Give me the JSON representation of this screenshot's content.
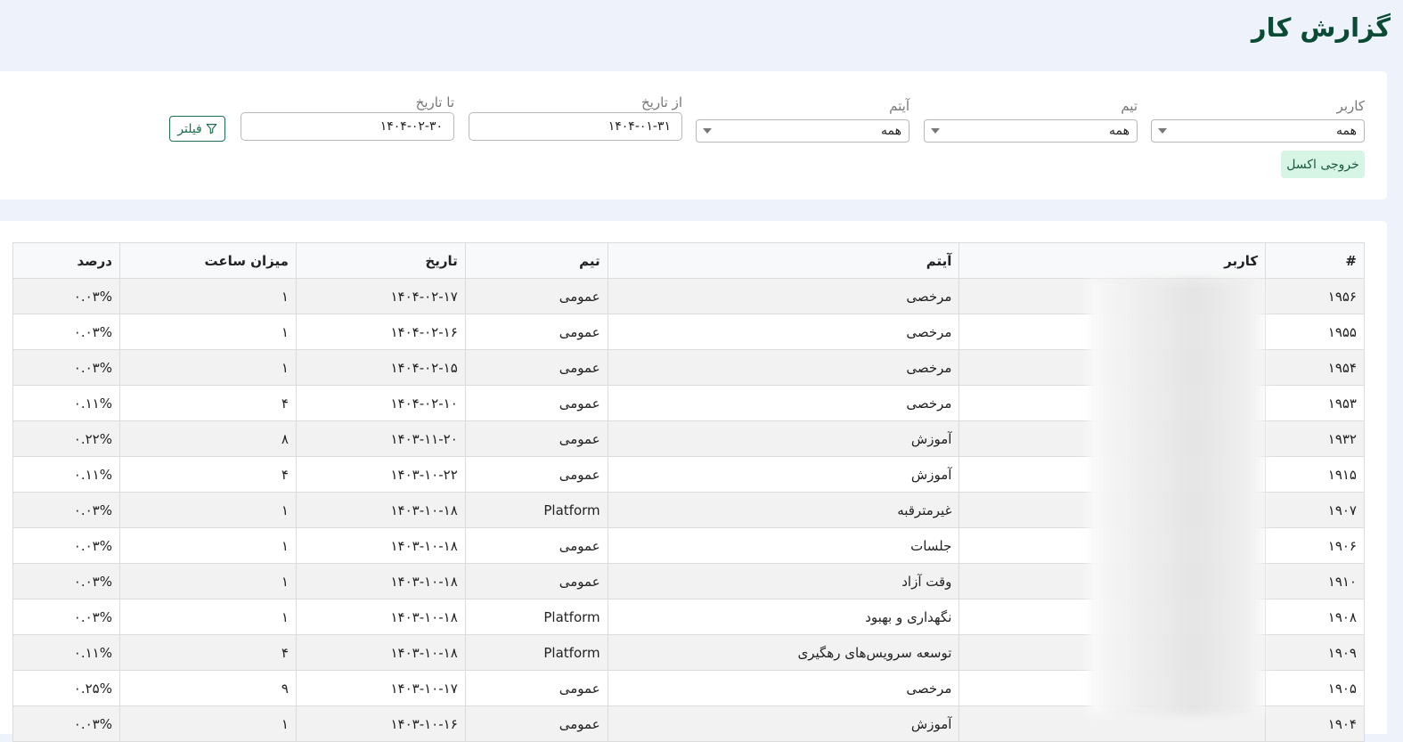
{
  "page": {
    "title": "گزارش کار"
  },
  "filters": {
    "user": {
      "label": "کاربر",
      "value": "همه"
    },
    "team": {
      "label": "تیم",
      "value": "همه"
    },
    "item": {
      "label": "آیتم",
      "value": "همه"
    },
    "from_date": {
      "label": "از تاریخ",
      "value": "۱۴۰۴-۰۱-۳۱"
    },
    "to_date": {
      "label": "تا تاریخ",
      "value": "۱۴۰۴-۰۲-۳۰"
    },
    "filter_button": "فیلتر",
    "excel_button": "خروجی اکسل"
  },
  "icons": {
    "filter": "funnel-icon",
    "dropdown": "chevron-down-icon"
  },
  "colors": {
    "title": "#0b4a35",
    "accent": "#1f6e4f",
    "excel_bg": "#d6f5e5"
  },
  "table": {
    "columns": [
      "#",
      "کاربر",
      "آیتم",
      "تیم",
      "تاریخ",
      "میزان ساعت",
      "درصد"
    ],
    "rows": [
      {
        "id": "۱۹۵۶",
        "user": "",
        "item": "مرخصی",
        "team": "عمومی",
        "date": "۱۴۰۴-۰۲-۱۷",
        "hours": "۱",
        "percent": "۰.۰۳%"
      },
      {
        "id": "۱۹۵۵",
        "user": "",
        "item": "مرخصی",
        "team": "عمومی",
        "date": "۱۴۰۴-۰۲-۱۶",
        "hours": "۱",
        "percent": "۰.۰۳%"
      },
      {
        "id": "۱۹۵۴",
        "user": "",
        "item": "مرخصی",
        "team": "عمومی",
        "date": "۱۴۰۴-۰۲-۱۵",
        "hours": "۱",
        "percent": "۰.۰۳%"
      },
      {
        "id": "۱۹۵۳",
        "user": "",
        "item": "مرخصی",
        "team": "عمومی",
        "date": "۱۴۰۴-۰۲-۱۰",
        "hours": "۴",
        "percent": "۰.۱۱%"
      },
      {
        "id": "۱۹۳۲",
        "user": "",
        "item": "آموزش",
        "team": "عمومی",
        "date": "۱۴۰۳-۱۱-۲۰",
        "hours": "۸",
        "percent": "۰.۲۲%"
      },
      {
        "id": "۱۹۱۵",
        "user": "",
        "item": "آموزش",
        "team": "عمومی",
        "date": "۱۴۰۳-۱۰-۲۲",
        "hours": "۴",
        "percent": "۰.۱۱%"
      },
      {
        "id": "۱۹۰۷",
        "user": "",
        "item": "غیرمترقبه",
        "team": "Platform",
        "date": "۱۴۰۳-۱۰-۱۸",
        "hours": "۱",
        "percent": "۰.۰۳%"
      },
      {
        "id": "۱۹۰۶",
        "user": "",
        "item": "جلسات",
        "team": "عمومی",
        "date": "۱۴۰۳-۱۰-۱۸",
        "hours": "۱",
        "percent": "۰.۰۳%"
      },
      {
        "id": "۱۹۱۰",
        "user": "",
        "item": "وقت آزاد",
        "team": "عمومی",
        "date": "۱۴۰۳-۱۰-۱۸",
        "hours": "۱",
        "percent": "۰.۰۳%"
      },
      {
        "id": "۱۹۰۸",
        "user": "",
        "item": "نگهداری و بهبود",
        "team": "Platform",
        "date": "۱۴۰۳-۱۰-۱۸",
        "hours": "۱",
        "percent": "۰.۰۳%"
      },
      {
        "id": "۱۹۰۹",
        "user": "",
        "item": "توسعه سرویس‌های رهگیری",
        "team": "Platform",
        "date": "۱۴۰۳-۱۰-۱۸",
        "hours": "۴",
        "percent": "۰.۱۱%"
      },
      {
        "id": "۱۹۰۵",
        "user": "",
        "item": "مرخصی",
        "team": "عمومی",
        "date": "۱۴۰۳-۱۰-۱۷",
        "hours": "۹",
        "percent": "۰.۲۵%"
      },
      {
        "id": "۱۹۰۴",
        "user": "",
        "item": "آموزش",
        "team": "عمومی",
        "date": "۱۴۰۳-۱۰-۱۶",
        "hours": "۱",
        "percent": "۰.۰۳%"
      }
    ]
  }
}
